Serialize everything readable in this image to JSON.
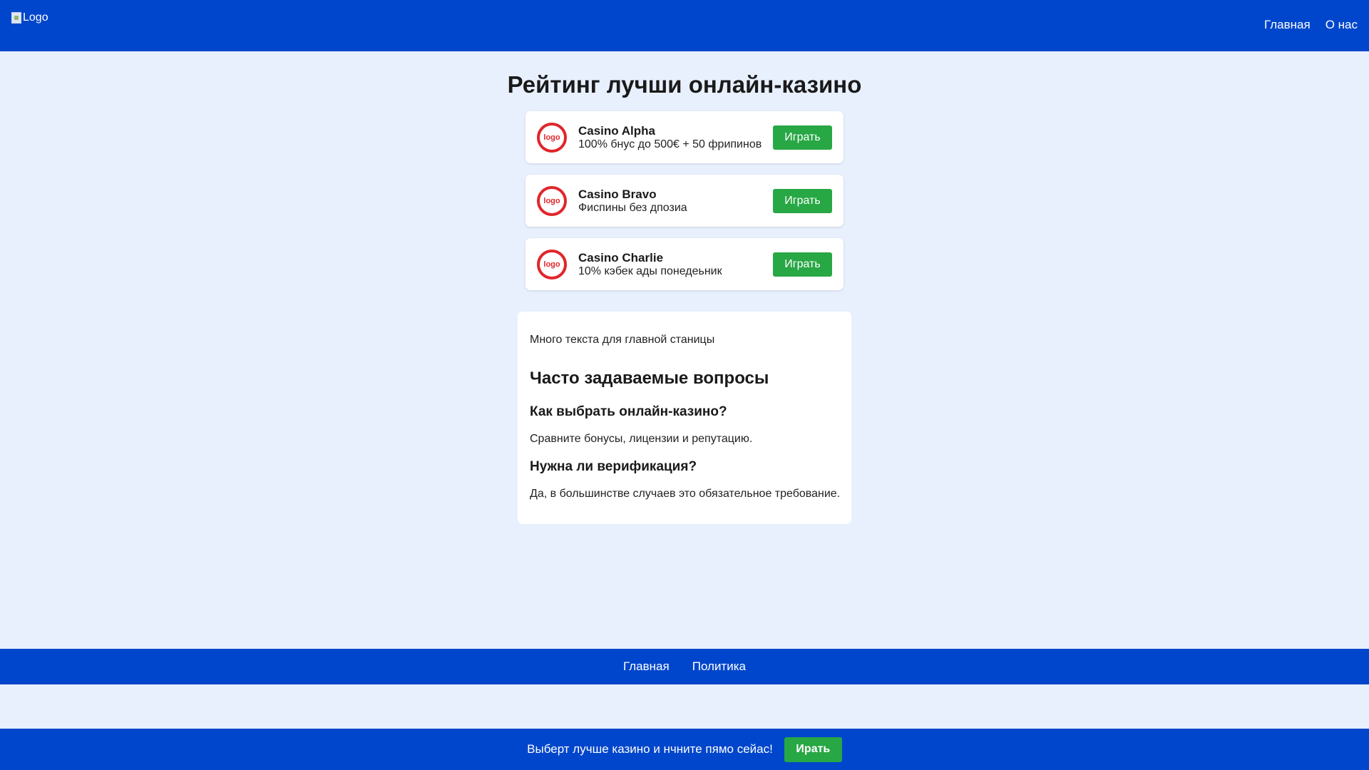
{
  "header": {
    "logo_alt": "Logo",
    "nav": [
      {
        "label": "Главная"
      },
      {
        "label": "О нас"
      }
    ]
  },
  "main": {
    "title": "Рейтинг лучши онлайн-казино",
    "casinos": [
      {
        "name": "Casino Alpha",
        "bonus": "100% бнус до 500€ + 50 фрипинов",
        "logo_text": "logo",
        "button": "Играть"
      },
      {
        "name": "Casino Bravo",
        "bonus": "Фиспины без дпозиа",
        "logo_text": "logo",
        "button": "Играть"
      },
      {
        "name": "Casino Charlie",
        "bonus": "10% кэбек ады понедеьник",
        "logo_text": "logo",
        "button": "Играть"
      }
    ],
    "content": {
      "intro": "Много текста для главной станицы",
      "faq_title": "Часто задаваемые вопросы",
      "faq": [
        {
          "q": "Как выбрать онлайн-казино?",
          "a": "Сравните бонусы, лицензии и репутацию."
        },
        {
          "q": "Нужна ли верификация?",
          "a": "Да, в большинстве случаев это обязательное требование."
        }
      ]
    }
  },
  "footer": {
    "links": [
      {
        "label": "Главная"
      },
      {
        "label": "Политика"
      }
    ]
  },
  "sticky": {
    "text": "Выберт лучше казино и нчните пямо сейас!",
    "button": "Ирать"
  },
  "colors": {
    "brand_blue": "#0046cc",
    "page_bg": "#e8f0fe",
    "play_green": "#28a745",
    "logo_red": "#e0262b"
  }
}
